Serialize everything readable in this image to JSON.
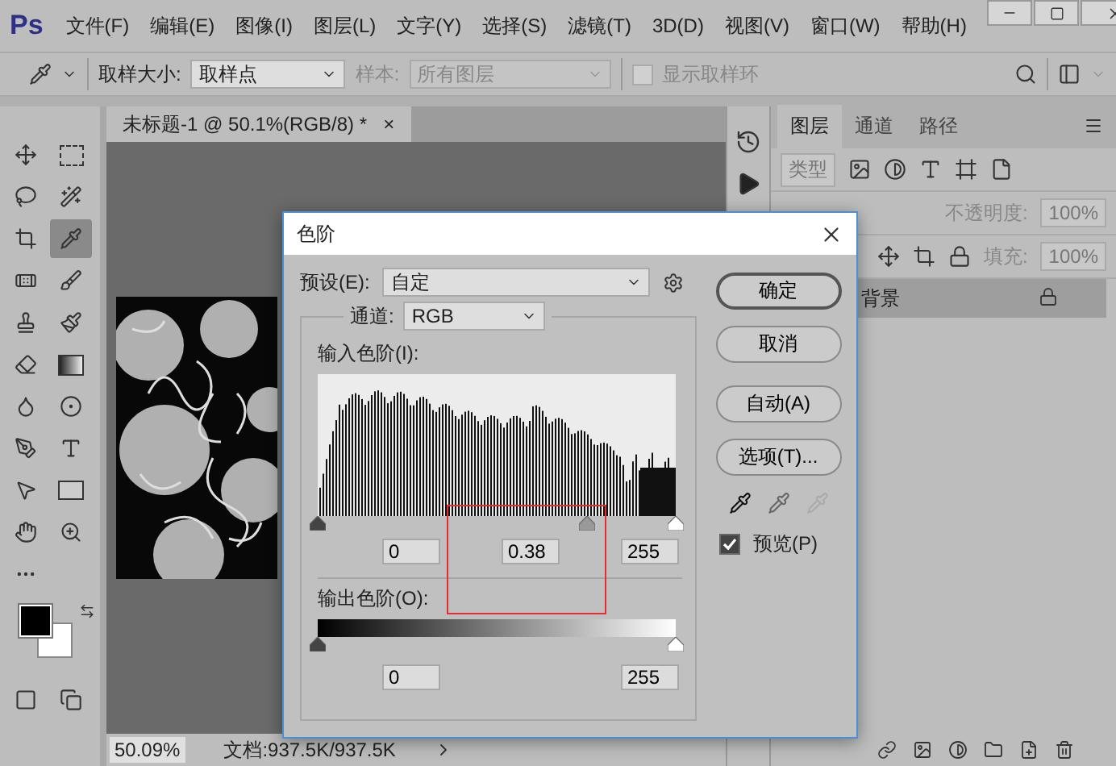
{
  "menu_bar": {
    "logo": "Ps",
    "menus": [
      "文件(F)",
      "编辑(E)",
      "图像(I)",
      "图层(L)",
      "文字(Y)",
      "选择(S)",
      "滤镜(T)",
      "3D(D)",
      "视图(V)",
      "窗口(W)",
      "帮助(H)"
    ]
  },
  "options_bar": {
    "sample_size": {
      "label": "取样大小:",
      "value": "取样点"
    },
    "sample": {
      "label": "样本:",
      "value": "所有图层",
      "disabled": true
    },
    "show_ring": {
      "label": "显示取样环",
      "checked": false,
      "disabled": true
    }
  },
  "toolbar": {
    "tools": [
      {
        "selected": false
      },
      {
        "selected": false
      },
      {
        "selected": false
      },
      {
        "selected": false
      },
      {
        "selected": false
      },
      {
        "selected": true
      },
      {
        "selected": false
      },
      {
        "selected": false
      },
      {
        "selected": false
      },
      {
        "selected": false
      },
      {
        "selected": false
      },
      {
        "selected": false
      },
      {
        "selected": false
      },
      {
        "selected": false
      },
      {
        "selected": false
      },
      {
        "selected": false
      },
      {
        "selected": false
      },
      {
        "selected": false
      },
      {
        "selected": false
      },
      {
        "selected": false
      },
      {
        "selected": false
      }
    ]
  },
  "document": {
    "tab": "未标题-1 @ 50.1%(RGB/8) *",
    "close": "×"
  },
  "status_bar": {
    "zoom": "50.09%",
    "doc_info": "文档:937.5K/937.5K"
  },
  "layers_panel": {
    "tabs": [
      {
        "label": "图层",
        "selected": true
      },
      {
        "label": "通道",
        "selected": false
      },
      {
        "label": "路径",
        "selected": false
      }
    ],
    "filter": "类型",
    "opacity": {
      "label": "不透明度:",
      "value": "100%"
    },
    "fill": {
      "label": "填充:",
      "value": "100%"
    },
    "layers": [
      {
        "name": "背景",
        "selected": true,
        "locked": true
      }
    ]
  },
  "levels_dialog": {
    "title": "色阶",
    "preset": {
      "label": "预设(E):",
      "value": "自定"
    },
    "channel": {
      "label": "通道:",
      "value": "RGB"
    },
    "input_label": "输入色阶(I):",
    "input_sliders": [
      {
        "level": 0
      },
      {
        "level": 0.75
      },
      {
        "level": 1
      }
    ],
    "input_values": [
      "0",
      "0.38",
      "255"
    ],
    "output_label": "输出色阶(O):",
    "output_sliders": [
      {
        "level": 0
      },
      {
        "level": 1
      }
    ],
    "output_values": [
      "0",
      "255"
    ],
    "buttons": [
      {
        "label": "确定",
        "default": true
      },
      {
        "label": "取消",
        "default": false
      },
      {
        "label": "自动(A)",
        "default": false
      },
      {
        "label": "选项(T)...",
        "default": false
      }
    ],
    "preview": {
      "label": "预览(P)",
      "checked": true
    }
  }
}
